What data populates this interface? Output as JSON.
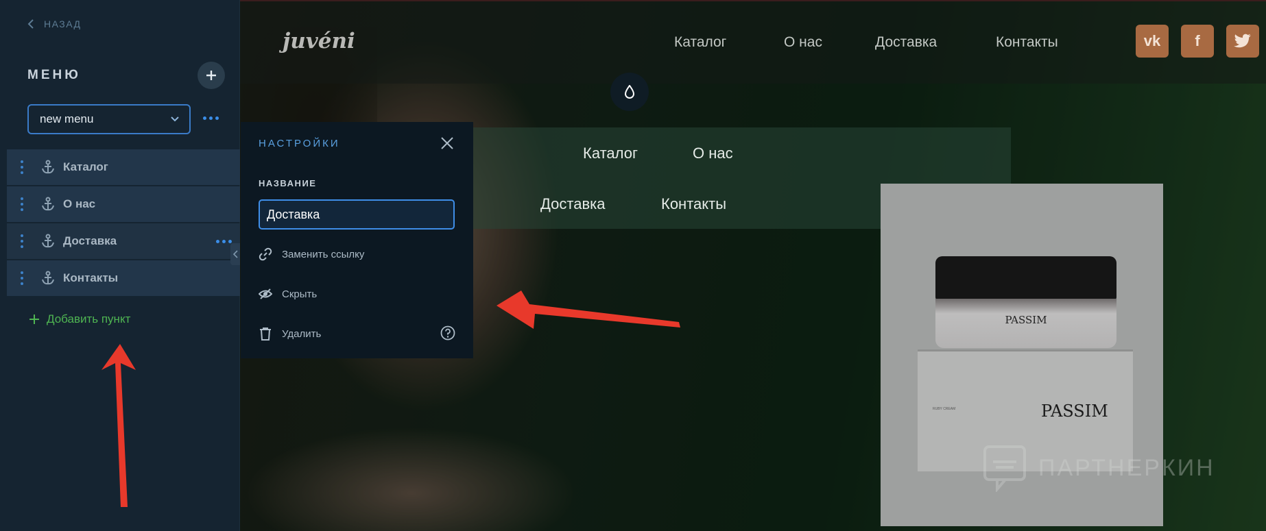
{
  "sidebar": {
    "back_label": "НАЗАД",
    "menu_title": "МЕНЮ",
    "menu_select_value": "new menu",
    "items": [
      {
        "label": "Каталог"
      },
      {
        "label": "О нас"
      },
      {
        "label": "Доставка"
      },
      {
        "label": "Контакты"
      }
    ],
    "add_item_label": "Добавить пункт"
  },
  "settings": {
    "title": "НАСТРОЙКИ",
    "name_label": "НАЗВАНИЕ",
    "name_value": "Доставка",
    "replace_link_label": "Заменить ссылку",
    "hide_label": "Скрыть",
    "delete_label": "Удалить"
  },
  "site": {
    "logo": "juvéni",
    "nav": [
      "Каталог",
      "О нас",
      "Доставка",
      "Контакты"
    ],
    "social": [
      "vk",
      "f",
      "twitter"
    ],
    "menu_block": [
      "Каталог",
      "О нас",
      "Доставка",
      "Контакты"
    ],
    "product_brand": "PASSIM",
    "box_brand": "PASSIM",
    "box_note": "RUBY CREAM"
  },
  "watermark": "ПАРТНЕРКИН",
  "colors": {
    "accent_blue": "#3b8ee8",
    "add_green": "#4fb552",
    "social_bg": "#a86a42",
    "annotation_red": "#e8392b"
  }
}
